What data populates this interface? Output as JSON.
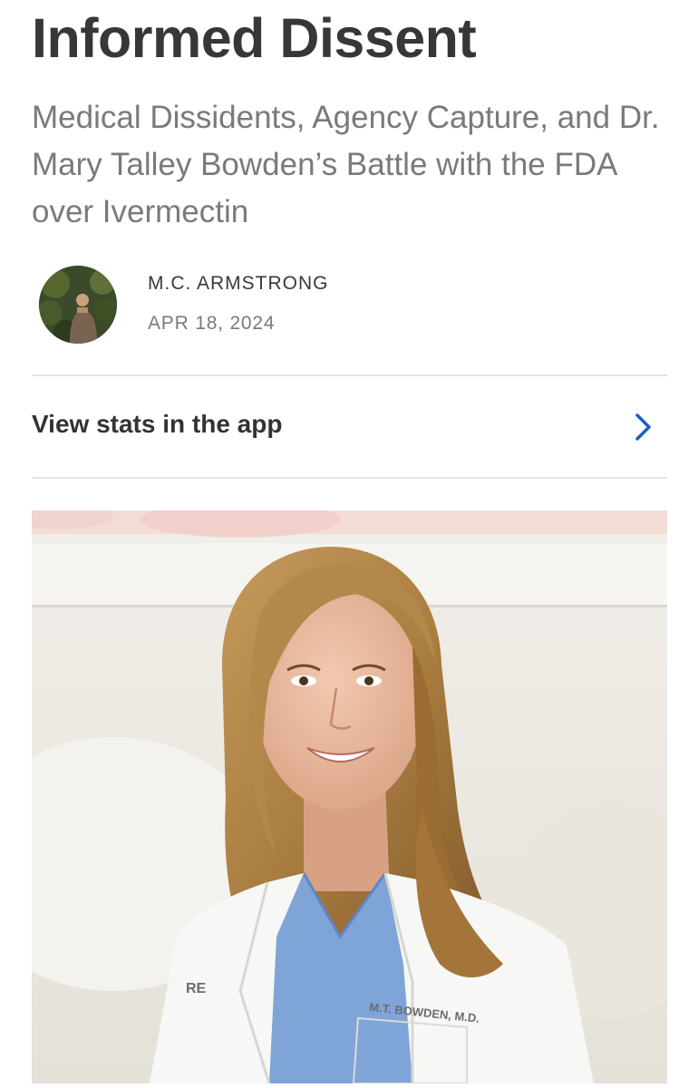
{
  "post": {
    "title": "Informed Dissent",
    "subtitle": "Medical Dissidents, Agency Capture, and Dr. Mary Talley Bowden’s Battle with the FDA over Ivermectin",
    "author": "M.C. ARMSTRONG",
    "date": "APR 18, 2024"
  },
  "stats": {
    "label": "View stats in the app",
    "icon": "chevron-right-icon",
    "icon_color": "#1a5fc1"
  },
  "hero_image": {
    "coat_text_left": "RE",
    "coat_text_right": "M.T. BOWDEN, M.D."
  },
  "colors": {
    "title": "#363737",
    "subtitle": "#7a7a7a",
    "divider": "#e3e3e3",
    "accent": "#1a5fc1"
  }
}
